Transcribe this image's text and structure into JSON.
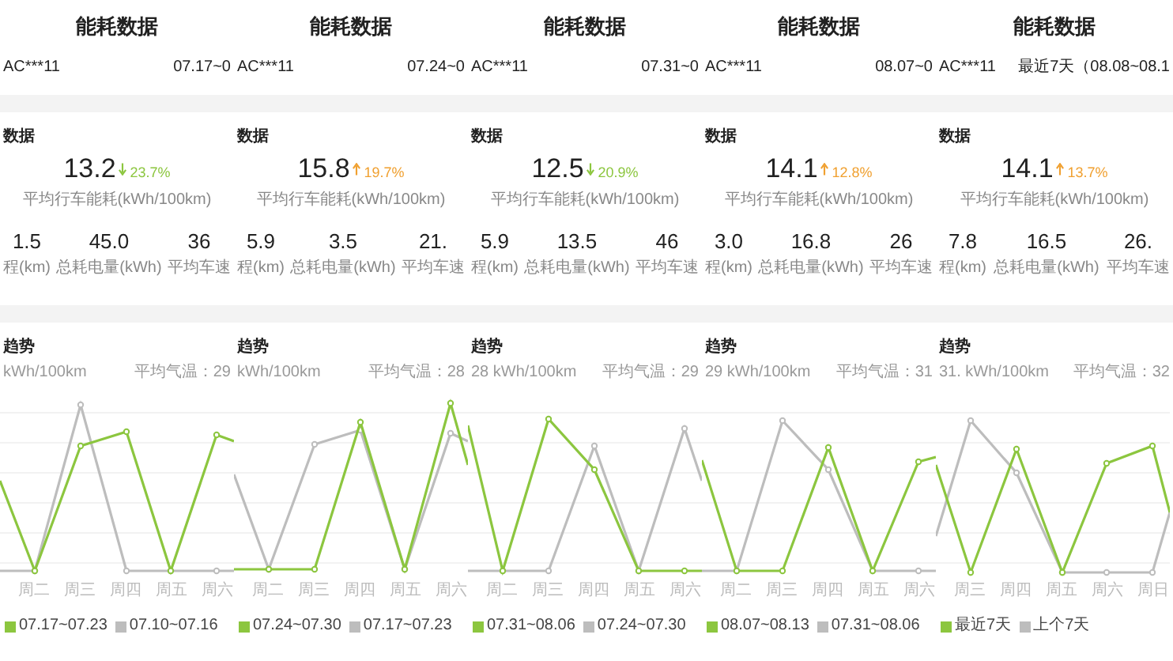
{
  "panels": [
    {
      "title": "能耗数据",
      "plate": "AC***11",
      "period": "07.17~0",
      "summary_heading": "数据",
      "consumption": "13.2",
      "change": {
        "text": "23.7%",
        "rising": false
      },
      "consumption_label": "平均行车能耗(kWh/100km)",
      "stats": [
        {
          "value": "1.5",
          "label": "程(km)"
        },
        {
          "value": "45.0",
          "label": "总耗电量(kWh)"
        },
        {
          "value": "36",
          "label": "平均车速"
        }
      ],
      "trend_heading": "趋势",
      "caption_left": "kWh/100km",
      "caption_right": "平均气温：29",
      "x_labels": [
        "周二",
        "周三",
        "周四",
        "周五",
        "周六"
      ],
      "legend": [
        {
          "label": "07.17~07.23",
          "color": "#8cc63f"
        },
        {
          "label": "07.10~07.16",
          "color": "#bdbdbd"
        }
      ]
    },
    {
      "title": "能耗数据",
      "plate": "AC***11",
      "period": "07.24~0",
      "summary_heading": "数据",
      "consumption": "15.8",
      "change": {
        "text": "19.7%",
        "rising": true
      },
      "consumption_label": "平均行车能耗(kWh/100km)",
      "stats": [
        {
          "value": "5.9",
          "label": "程(km)"
        },
        {
          "value": "3.5",
          "label": "总耗电量(kWh)"
        },
        {
          "value": "21.",
          "label": "平均车速"
        }
      ],
      "trend_heading": "趋势",
      "caption_left": "kWh/100km",
      "caption_right": "平均气温：28",
      "x_labels": [
        "周二",
        "周三",
        "周四",
        "周五",
        "周六"
      ],
      "legend": [
        {
          "label": "07.24~07.30",
          "color": "#8cc63f"
        },
        {
          "label": "07.17~07.23",
          "color": "#bdbdbd"
        }
      ]
    },
    {
      "title": "能耗数据",
      "plate": "AC***11",
      "period": "07.31~0",
      "summary_heading": "数据",
      "consumption": "12.5",
      "change": {
        "text": "20.9%",
        "rising": false
      },
      "consumption_label": "平均行车能耗(kWh/100km)",
      "stats": [
        {
          "value": "5.9",
          "label": "程(km)"
        },
        {
          "value": "13.5",
          "label": "总耗电量(kWh)"
        },
        {
          "value": "46",
          "label": "平均车速"
        }
      ],
      "trend_heading": "趋势",
      "caption_left": "28 kWh/100km",
      "caption_right": "平均气温：29",
      "x_labels": [
        "周二",
        "周三",
        "周四",
        "周五",
        "周六"
      ],
      "legend": [
        {
          "label": "07.31~08.06",
          "color": "#8cc63f"
        },
        {
          "label": "07.24~07.30",
          "color": "#bdbdbd"
        }
      ]
    },
    {
      "title": "能耗数据",
      "plate": "AC***11",
      "period": "08.07~0",
      "summary_heading": "数据",
      "consumption": "14.1",
      "change": {
        "text": "12.8%",
        "rising": true
      },
      "consumption_label": "平均行车能耗(kWh/100km)",
      "stats": [
        {
          "value": "3.0",
          "label": "程(km)"
        },
        {
          "value": "16.8",
          "label": "总耗电量(kWh)"
        },
        {
          "value": "26",
          "label": "平均车速"
        }
      ],
      "trend_heading": "趋势",
      "caption_left": "29 kWh/100km",
      "caption_right": "平均气温：31",
      "x_labels": [
        "周二",
        "周三",
        "周四",
        "周五",
        "周六"
      ],
      "legend": [
        {
          "label": "08.07~08.13",
          "color": "#8cc63f"
        },
        {
          "label": "07.31~08.06",
          "color": "#bdbdbd"
        }
      ]
    },
    {
      "title": "能耗数据",
      "plate": "AC***11",
      "period": "最近7天（08.08~08.1",
      "summary_heading": "数据",
      "consumption": "14.1",
      "change": {
        "text": "13.7%",
        "rising": true
      },
      "consumption_label": "平均行车能耗(kWh/100km)",
      "stats": [
        {
          "value": "7.8",
          "label": "程(km)"
        },
        {
          "value": "16.5",
          "label": "总耗电量(kWh)"
        },
        {
          "value": "26.",
          "label": "平均车速"
        }
      ],
      "trend_heading": "趋势",
      "caption_left": "31. kWh/100km",
      "caption_right": "平均气温：32",
      "x_labels": [
        "周三",
        "周四",
        "周五",
        "周六",
        "周日"
      ],
      "legend": [
        {
          "label": "最近7天",
          "color": "#8cc63f"
        },
        {
          "label": "上个7天",
          "color": "#bdbdbd"
        }
      ]
    }
  ]
}
